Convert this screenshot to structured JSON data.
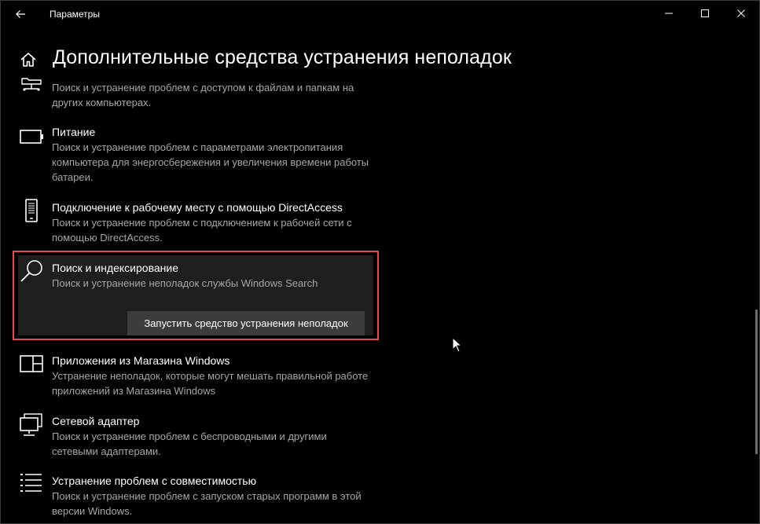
{
  "window": {
    "title": "Параметры"
  },
  "page": {
    "title": "Дополнительные средства устранения неполадок"
  },
  "items": [
    {
      "name": "",
      "desc": "Поиск и устранение проблем с доступом к файлам и папкам на других компьютерах.",
      "icon": "shared-folders-icon"
    },
    {
      "name": "Питание",
      "desc": "Поиск и устранение проблем с параметрами электропитания компьютера для энергосбережения и увеличения  времени работы батареи.",
      "icon": "battery-icon"
    },
    {
      "name": "Подключение к рабочему месту с помощью DirectAccess",
      "desc": "Поиск и устранение проблем с подключением к рабочей сети с помощью DirectAccess.",
      "icon": "phone-icon"
    },
    {
      "name": "Поиск и индексирование",
      "desc": "Поиск и устранение неполадок службы Windows Search",
      "icon": "search-icon"
    },
    {
      "name": "Приложения из Магазина Windows",
      "desc": "Устранение неполадок, которые могут мешать правильной работе приложений из Магазина Windows",
      "icon": "store-apps-icon"
    },
    {
      "name": "Сетевой адаптер",
      "desc": "Поиск и устранение проблем с беспроводными и другими сетевыми адаптерами.",
      "icon": "network-adapter-icon"
    },
    {
      "name": "Устранение проблем с совместимостью",
      "desc": "Поиск и устранение проблем с запуском старых программ в этой версии Windows.",
      "icon": "compatibility-list-icon"
    }
  ],
  "run_button": {
    "label": "Запустить средство устранения неполадок"
  },
  "colors": {
    "background": "#000000",
    "selected_bg": "#1e1e1e",
    "highlight_border": "#e04a4a",
    "button_bg": "#3c3c3c",
    "secondary_text": "#a6a6a6"
  }
}
